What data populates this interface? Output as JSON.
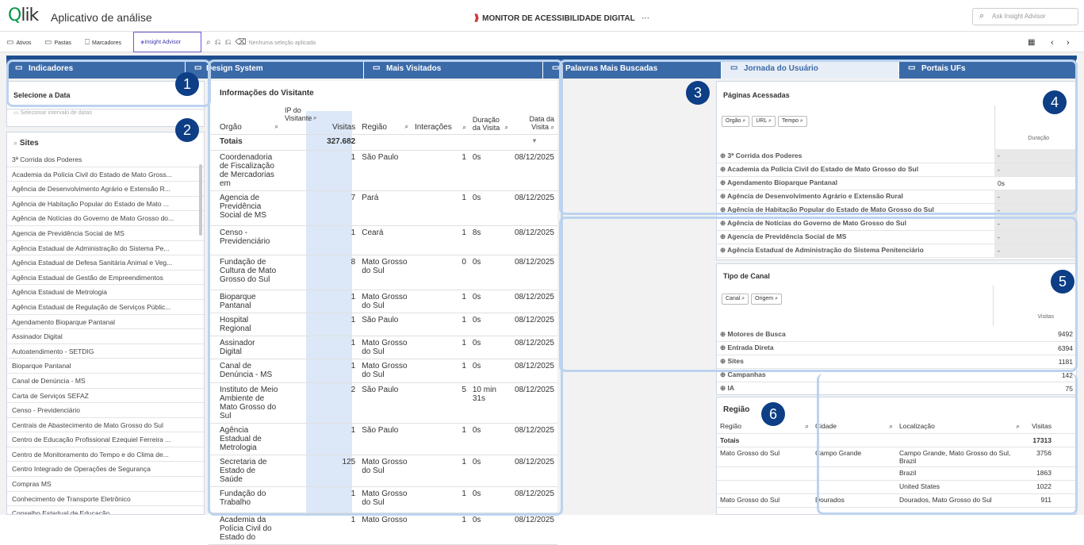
{
  "header": {
    "app_title": "Aplicativo de análise",
    "center_title": "MONITOR DE ACESSIBILIDADE DIGITAL",
    "more": "···",
    "ask_placeholder": "Ask Insight Advisor"
  },
  "toolbar": {
    "ativos": "Ativos",
    "pastas": "Pastas",
    "marcadores": "Marcadores",
    "insight": "Insight Advisor",
    "selection": "Nenhuma seleção aplicada"
  },
  "tabs": [
    {
      "label": "Indicadores"
    },
    {
      "label": "Design System"
    },
    {
      "label": "Mais Visitados"
    },
    {
      "label": "Palavras Mais Buscadas"
    },
    {
      "label": "Jornada do Usuário"
    },
    {
      "label": "Portais UFs"
    }
  ],
  "badges": [
    "1",
    "2",
    "3",
    "4",
    "5",
    "6"
  ],
  "left": {
    "select_date": "Selecione a Data",
    "date_hint": "Selecionar intervalo de datas",
    "sites_title": "Sites",
    "sites": [
      "3ª Corrida dos Poderes",
      "Academia da Polícia Civil do Estado de Mato Gross...",
      "Agência de Desenvolvimento Agrário e Extensão R...",
      "Agência de Habitação Popular do Estado de Mato ...",
      "Agência de Notícias do Governo de Mato Grosso do...",
      "Agencia de Previdência Social de MS",
      "Agência Estadual de Administração do Sistema Pe...",
      "Agência Estadual de Defesa Sanitária Animal e Veg...",
      "Agência Estadual de Gestão de Empreendimentos",
      "Agência Estadual de Metrologia",
      "Agência Estadual de Regulação de Serviços Públic...",
      "Agendamento Bioparque Pantanal",
      "Assinador Digital",
      "Autoatendimento - SETDIG",
      "Bioparque Pantanal",
      "Canal de Denúncia - MS",
      "Carta de Serviços SEFAZ",
      "Censo - Previdenciário",
      "Centrais de Abastecimento de Mato Grosso do Sul",
      "Centro de Educação Profissional Ezequiel Ferreira ...",
      "Centro de Monitoramento do Tempo e do Clima de...",
      "Centro Integrado de Operações de Segurança",
      "Compras MS",
      "Conhecimento de Transporte Eletrônico",
      "Conselho Estadual de Educação"
    ]
  },
  "visitor": {
    "title": "Informações do Visitante",
    "cols": {
      "orgao": "Orgão",
      "ip": "IP do Visitante",
      "visitas": "Visitas",
      "regiao": "Região",
      "interacoes": "Interações",
      "duracao": "Duração da Visita",
      "data": "Data da Visita"
    },
    "totals_label": "Totais",
    "totals_value": "327.682",
    "rows": [
      {
        "orgao": "Coordenadoria de Fiscalização de Mercadorias em",
        "visitas": "1",
        "regiao": "São Paulo",
        "n": "1",
        "dur": "0s",
        "data": "08/12/2025",
        "h": 44
      },
      {
        "orgao": "Agencia de Previdência Social de MS",
        "visitas": "7",
        "regiao": "Pará",
        "n": "1",
        "dur": "0s",
        "data": "08/12/2025",
        "h": 44
      },
      {
        "orgao": "Censo - Previdenciário",
        "visitas": "1",
        "regiao": "Ceará",
        "n": "1",
        "dur": "8s",
        "data": "08/12/2025",
        "h": 37
      },
      {
        "orgao": "Fundação de Cultura de Mato Grosso do Sul",
        "visitas": "8",
        "regiao": "Mato Grosso do Sul",
        "n": "0",
        "dur": "0s",
        "data": "08/12/2025",
        "h": 44
      },
      {
        "orgao": "Bioparque Pantanal",
        "visitas": "1",
        "regiao": "Mato Grosso do Sul",
        "n": "1",
        "dur": "0s",
        "data": "08/12/2025",
        "h": 17
      },
      {
        "orgao": "Hospital Regional",
        "visitas": "1",
        "regiao": "São Paulo",
        "n": "1",
        "dur": "0s",
        "data": "08/12/2025",
        "h": 17
      },
      {
        "orgao": "Assinador Digital",
        "visitas": "1",
        "regiao": "Mato Grosso do Sul",
        "n": "1",
        "dur": "0s",
        "data": "08/12/2025",
        "h": 17
      },
      {
        "orgao": "Canal de Denúncia - MS",
        "visitas": "1",
        "regiao": "Mato Grosso do Sul",
        "n": "1",
        "dur": "0s",
        "data": "08/12/2025",
        "h": 30
      },
      {
        "orgao": "Instituto de Meio Ambiente de Mato Grosso do Sul",
        "visitas": "2",
        "regiao": "São Paulo",
        "n": "5",
        "dur": "10 min 31s",
        "data": "08/12/2025",
        "h": 48
      },
      {
        "orgao": "Agência Estadual de Metrologia",
        "visitas": "1",
        "regiao": "São Paulo",
        "n": "1",
        "dur": "0s",
        "data": "08/12/2025",
        "h": 30
      },
      {
        "orgao": "Secretaria de Estado de Saúde",
        "visitas": "125",
        "regiao": "Mato Grosso do Sul",
        "n": "1",
        "dur": "0s",
        "data": "08/12/2025",
        "h": 33
      },
      {
        "orgao": "Fundação do Trabalho",
        "visitas": "1",
        "regiao": "Mato Grosso do Sul",
        "n": "1",
        "dur": "0s",
        "data": "08/12/2025",
        "h": 33
      },
      {
        "orgao": "Academia da Polícia Civil do Estado do",
        "visitas": "1",
        "regiao": "Mato Grosso",
        "n": "1",
        "dur": "0s",
        "data": "08/12/2025",
        "h": 30
      }
    ]
  },
  "paginas": {
    "title": "Páginas Acessadas",
    "chips": [
      "Orgão",
      "URL",
      "Tempo"
    ],
    "col": "Duração",
    "rows": [
      [
        "3ª Corrida dos Poderes",
        "-"
      ],
      [
        "Academia da Polícia Civil do Estado de Mato Grosso do Sul",
        "-"
      ],
      [
        "Agendamento Bioparque Pantanal",
        "0s"
      ],
      [
        "Agência de Desenvolvimento Agrário e Extensão Rural",
        "-"
      ],
      [
        "Agência de Habitação Popular do Estado de Mato Grosso do Sul",
        "-"
      ],
      [
        "Agência de Notícias do Governo de Mato Grosso do Sul",
        "-"
      ],
      [
        "Agencia de Previdência Social de MS",
        "-"
      ],
      [
        "Agência Estadual de Administração do Sistema Penitenciário",
        "-"
      ]
    ]
  },
  "canal": {
    "title": "Tipo de Canal",
    "chips": [
      "Canal",
      "Origem"
    ],
    "col": "Visitas",
    "rows": [
      [
        "Motores de Busca",
        "9492"
      ],
      [
        "Entrada Direta",
        "6394"
      ],
      [
        "Sites",
        "1181"
      ],
      [
        "Campanhas",
        "142"
      ],
      [
        "IA",
        "75"
      ]
    ]
  },
  "regiao": {
    "title": "Região",
    "cols": [
      "Região",
      "Cidade",
      "Localização",
      "Visitas"
    ],
    "totals": "Totais",
    "total_value": "17313",
    "rows": [
      [
        "Mato Grosso do Sul",
        "Campo Grande",
        "Campo Grande, Mato Grosso do Sul, Brazil",
        "3756"
      ],
      [
        "",
        "",
        "Brazil",
        "1863"
      ],
      [
        "",
        "",
        "United States",
        "1022"
      ],
      [
        "Mato Grosso do Sul",
        "Dourados",
        "Dourados, Mato Grosso do Sul",
        "911"
      ]
    ]
  }
}
